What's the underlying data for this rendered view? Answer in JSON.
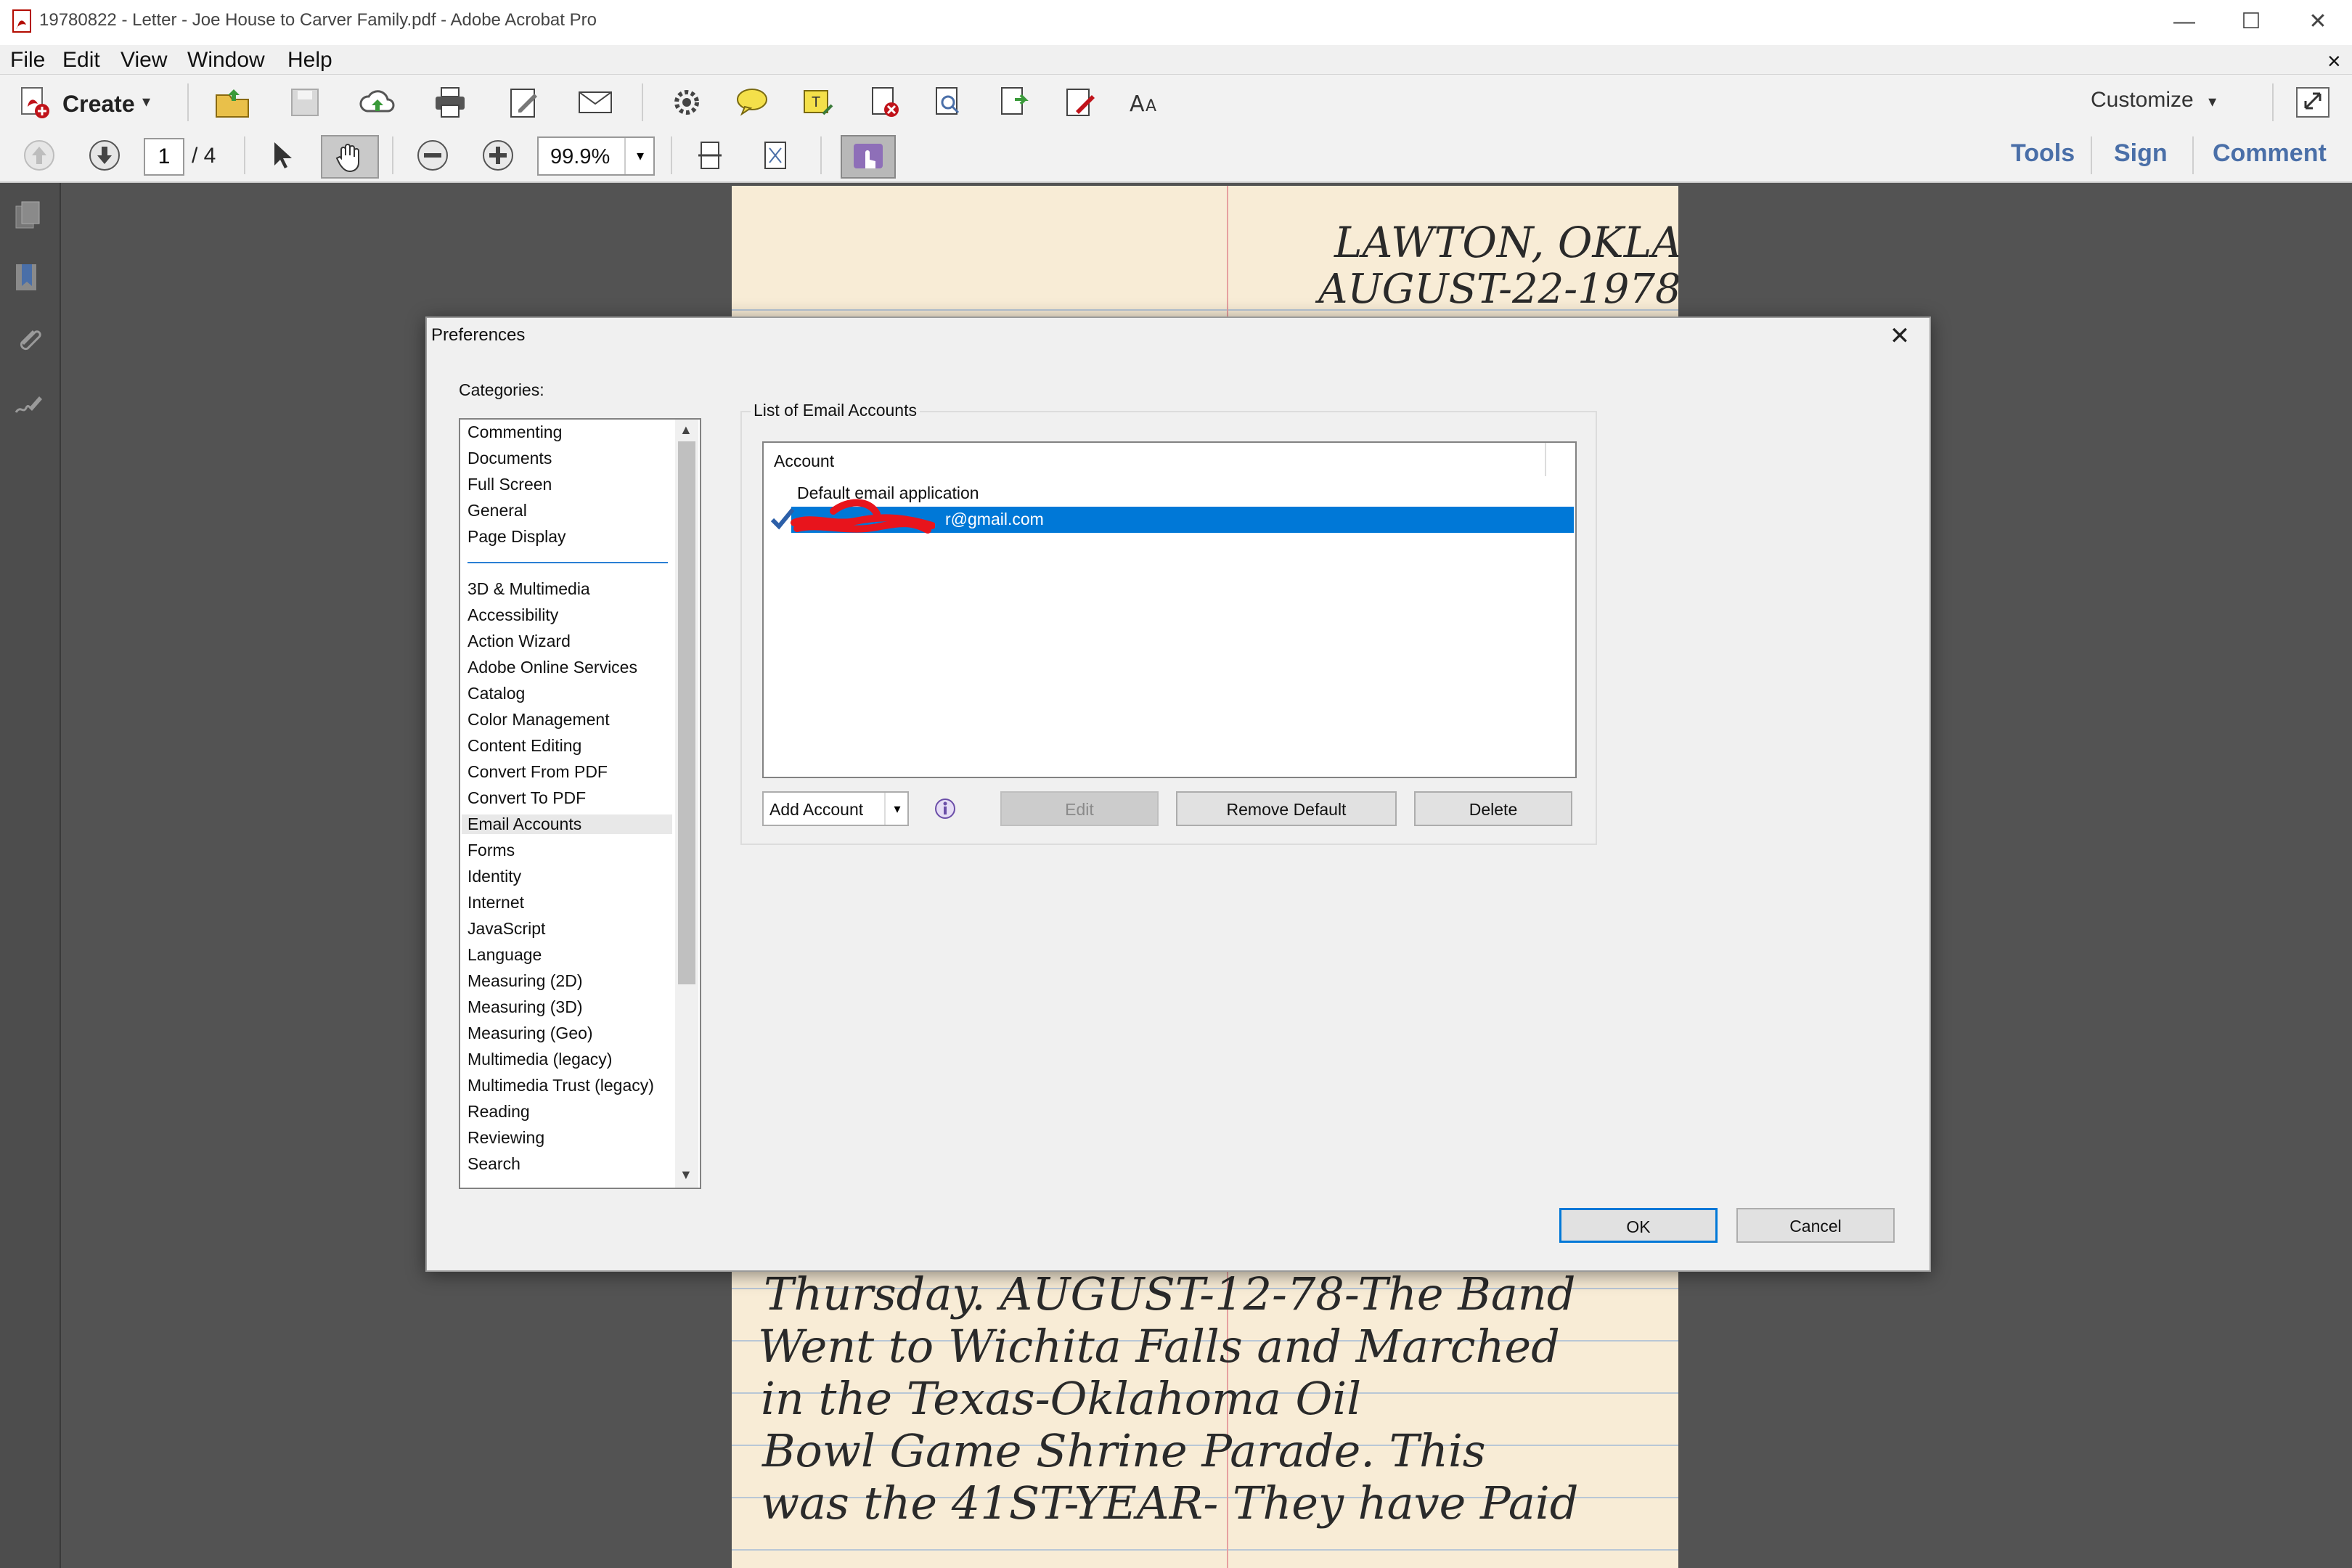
{
  "window": {
    "title": "19780822 - Letter - Joe House to Carver Family.pdf - Adobe Acrobat Pro",
    "minimize": "—",
    "maximize": "☐",
    "close": "✕",
    "menubar_close": "×"
  },
  "menu": {
    "file": "File",
    "edit": "Edit",
    "window": "Window",
    "help": "Help"
  },
  "toolbar1": {
    "create_label": "Create",
    "customize_label": "Customize"
  },
  "toolbar2": {
    "page_number": "1",
    "page_total": "/ 4",
    "zoom": "99.9%",
    "tools": "Tools",
    "sign": "Sign",
    "comment": "Comment"
  },
  "document": {
    "header_line1": "LAWTON, OKLA",
    "header_line2": "AUGUST-22-1978",
    "body_lines": [
      "Thursday. AUGUST-12-78-The Band",
      "Went to Wichita Falls and Marched",
      "in the Texas-Oklahoma Oil",
      "Bowl Game Shrine Parade. This",
      "was the 41ST-YEAR- They have Paid"
    ]
  },
  "dialog": {
    "title": "Preferences",
    "close": "✕",
    "categories_label": "Categories:",
    "categories_group1": [
      "Commenting",
      "Documents",
      "Full Screen",
      "General",
      "Page Display"
    ],
    "categories_group2": [
      "3D & Multimedia",
      "Accessibility",
      "Action Wizard",
      "Adobe Online Services",
      "Catalog",
      "Color Management",
      "Content Editing",
      "Convert From PDF",
      "Convert To PDF",
      "Email Accounts",
      "Forms",
      "Identity",
      "Internet",
      "JavaScript",
      "Language",
      "Measuring (2D)",
      "Measuring (3D)",
      "Measuring (Geo)",
      "Multimedia (legacy)",
      "Multimedia Trust (legacy)",
      "Reading",
      "Reviewing",
      "Search"
    ],
    "selected_category": "Email Accounts",
    "group_label": "List of Email Accounts",
    "account_header": "Account",
    "accounts": [
      {
        "name": "Default email application",
        "selected": false,
        "default": false
      },
      {
        "name": "r@gmail.com",
        "selected": true,
        "default": true
      }
    ],
    "add_account": "Add Account",
    "edit": "Edit",
    "remove_default": "Remove Default",
    "delete": "Delete",
    "ok": "OK",
    "cancel": "Cancel"
  },
  "colors": {
    "selection": "#0078d7",
    "link_blue": "#4a6fa8",
    "redaction": "#e8141c"
  }
}
